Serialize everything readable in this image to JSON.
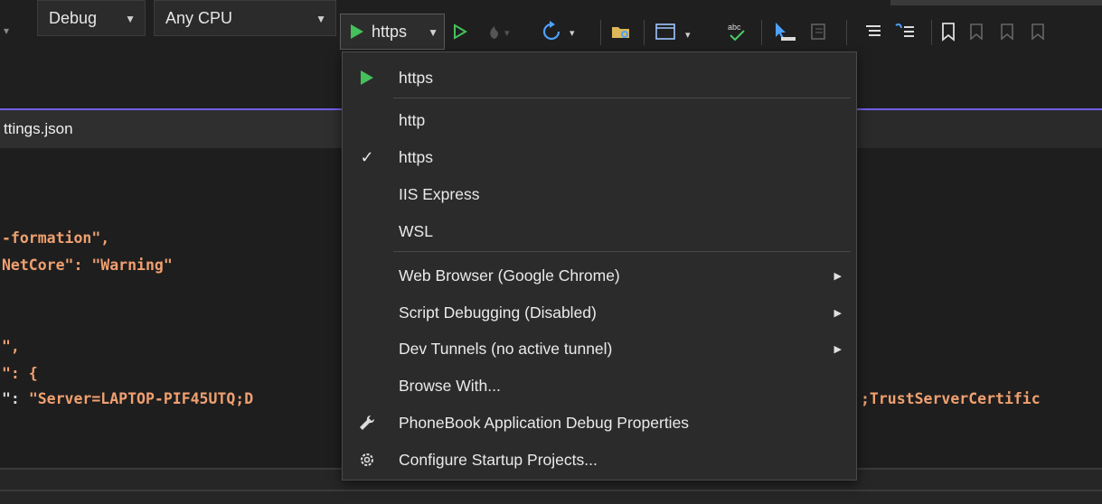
{
  "toolbar": {
    "config": "Debug",
    "platform": "Any CPU",
    "run_target": "https"
  },
  "tab": {
    "title": "ttings.json"
  },
  "code": {
    "line1a": "-formation\",",
    "line2a": "NetCore\": ",
    "line2b": "\"Warning\"",
    "line3": "\",",
    "line4": "\": {",
    "line5a": "\": ",
    "line5b": "\"Server=LAPTOP-PIF45UTQ;D",
    "line5c": ";TrustServerCertific"
  },
  "menu": {
    "run_item": "https",
    "profiles": [
      "http",
      "https",
      "IIS Express",
      "WSL"
    ],
    "checked_profile": "https",
    "web_browser": "Web Browser (Google Chrome)",
    "script_debugging": "Script Debugging (Disabled)",
    "dev_tunnels": "Dev Tunnels (no active tunnel)",
    "browse_with": "Browse With...",
    "debug_properties": "PhoneBook Application Debug Properties",
    "configure_startup": "Configure Startup Projects..."
  },
  "colors": {
    "accent": "#7160e8",
    "play_green": "#45c15c",
    "string_orange": "#f0a070",
    "menu_bg": "#2b2b2b"
  }
}
